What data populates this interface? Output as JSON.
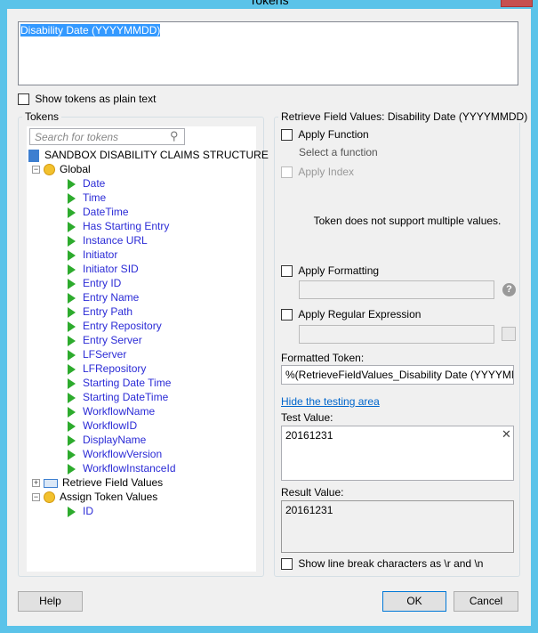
{
  "window": {
    "title": "Tokens"
  },
  "token_text": "Disability Date (YYYYMMDD)",
  "show_plain_text_label": "Show tokens as plain text",
  "tokens_panel": {
    "label": "Tokens",
    "search_placeholder": "Search for tokens",
    "root": "SANDBOX DISABILITY CLAIMS STRUCTURE",
    "global": "Global",
    "global_items": [
      "Date",
      "Time",
      "DateTime",
      "Has Starting Entry",
      "Instance URL",
      "Initiator",
      "Initiator SID",
      "Entry ID",
      "Entry Name",
      "Entry Path",
      "Entry Repository",
      "Entry Server",
      "LFServer",
      "LFRepository",
      "Starting Date Time",
      "Starting DateTime",
      "WorkflowName",
      "WorkflowID",
      "DisplayName",
      "WorkflowVersion",
      "WorkflowInstanceId"
    ],
    "retrieve": "Retrieve Field Values",
    "assign": "Assign Token Values",
    "assign_items": [
      "ID"
    ]
  },
  "right_panel": {
    "label": "Retrieve Field Values: Disability Date (YYYYMMDD)",
    "apply_function": "Apply Function",
    "select_function": "Select a function",
    "apply_index": "Apply Index",
    "multi_note": "Token does not support multiple values.",
    "apply_formatting": "Apply Formatting",
    "apply_regex": "Apply Regular Expression",
    "formatted_label": "Formatted Token:",
    "formatted_value": "%(RetrieveFieldValues_Disability Date (YYYYMMDD))",
    "hide_testing": "Hide the testing area",
    "test_label": "Test Value:",
    "test_value": "20161231",
    "result_label": "Result Value:",
    "result_value": "20161231",
    "line_breaks": "Show line break characters as \\r and \\n"
  },
  "buttons": {
    "help": "Help",
    "ok": "OK",
    "cancel": "Cancel"
  }
}
